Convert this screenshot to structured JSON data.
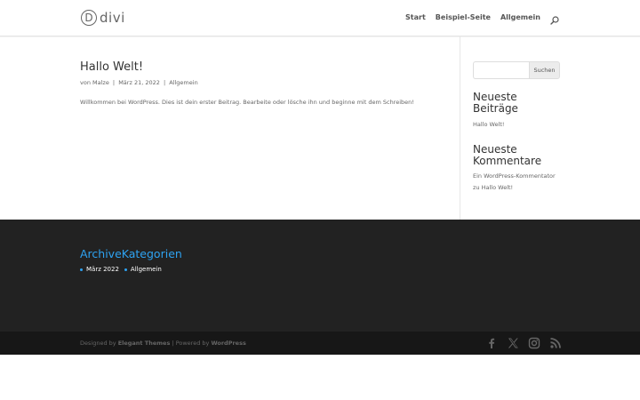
{
  "logo": {
    "letter": "D",
    "text": "divi"
  },
  "nav": {
    "items": [
      "Start",
      "Beispiel-Seite",
      "Allgemein"
    ]
  },
  "post": {
    "title": "Hallo Welt!",
    "meta_by": "von",
    "author": "Malze",
    "date": "März 21, 2022",
    "category": "Allgemein",
    "separator": "|",
    "excerpt": "Willkommen bei WordPress. Dies ist dein erster Beitrag. Bearbeite oder lösche ihn und beginne mit dem Schreiben!"
  },
  "sidebar": {
    "search": {
      "value": "",
      "button_label": "Suchen"
    },
    "recent_posts": {
      "title": "Neueste Beiträge",
      "items": [
        "Hallo Welt!"
      ]
    },
    "recent_comments": {
      "title": "Neueste Kommentare",
      "author": "Ein WordPress-Kommentator",
      "connector": "zu",
      "post": "Hallo Welt!"
    }
  },
  "footer": {
    "title": "ArchiveKategorien",
    "items": [
      "März 2022",
      "Allgemein"
    ]
  },
  "bottom_bar": {
    "designed_by": "Designed by",
    "theme": "Elegant Themes",
    "separator": "|",
    "powered_by": "Powered by",
    "platform": "WordPress",
    "social_icons": [
      "facebook-icon",
      "x-icon",
      "instagram-icon",
      "rss-icon"
    ]
  },
  "colors": {
    "accent": "#2ea3f2",
    "footer_bg": "#222222",
    "bottom_bar_bg": "#171717"
  }
}
